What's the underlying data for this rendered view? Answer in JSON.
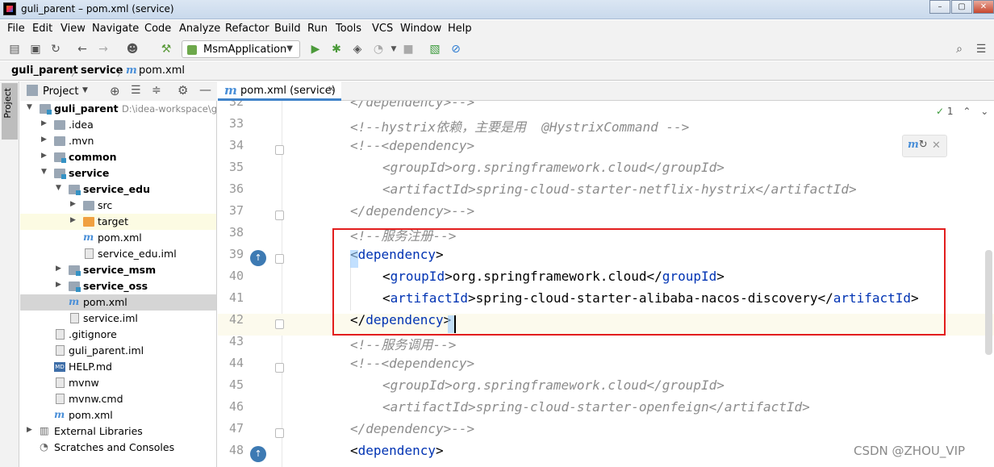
{
  "window": {
    "title": "guli_parent – pom.xml (service)"
  },
  "menu": [
    "File",
    "Edit",
    "View",
    "Navigate",
    "Code",
    "Analyze",
    "Refactor",
    "Build",
    "Run",
    "Tools",
    "VCS",
    "Window",
    "Help"
  ],
  "toolbar": {
    "run_config": "MsmApplication"
  },
  "breadcrumb": [
    "guli_parent",
    "service",
    "pom.xml"
  ],
  "project_panel": {
    "title": "Project"
  },
  "tree": [
    {
      "label": "guli_parent",
      "path": "D:\\idea-workspace\\gu",
      "bold": true
    },
    {
      "label": ".idea"
    },
    {
      "label": ".mvn"
    },
    {
      "label": "common",
      "bold": true
    },
    {
      "label": "service",
      "bold": true
    },
    {
      "label": "service_edu",
      "bold": true
    },
    {
      "label": "src"
    },
    {
      "label": "target"
    },
    {
      "label": "pom.xml"
    },
    {
      "label": "service_edu.iml"
    },
    {
      "label": "service_msm",
      "bold": true
    },
    {
      "label": "service_oss",
      "bold": true
    },
    {
      "label": "pom.xml"
    },
    {
      "label": "service.iml"
    },
    {
      "label": ".gitignore"
    },
    {
      "label": "guli_parent.iml"
    },
    {
      "label": "HELP.md"
    },
    {
      "label": "mvnw"
    },
    {
      "label": "mvnw.cmd"
    },
    {
      "label": "pom.xml"
    },
    {
      "label": "External Libraries"
    },
    {
      "label": "Scratches and Consoles"
    }
  ],
  "editor": {
    "tab": "pom.xml (service)",
    "inspection_count": "1",
    "lines": [
      {
        "n": "32",
        "indent": 0,
        "parts": [
          [
            "cmt",
            "</dependency>-->"
          ]
        ]
      },
      {
        "n": "33",
        "indent": 0,
        "parts": [
          [
            "cmt",
            "<!--hystrix依赖，主要是用  @HystrixCommand -->"
          ]
        ]
      },
      {
        "n": "34",
        "indent": 0,
        "parts": [
          [
            "cmt",
            "<!--<dependency>"
          ]
        ]
      },
      {
        "n": "35",
        "indent": 1,
        "parts": [
          [
            "cmt",
            "<groupId>org.springframework.cloud</groupId>"
          ]
        ]
      },
      {
        "n": "36",
        "indent": 1,
        "parts": [
          [
            "cmt",
            "<artifactId>spring-cloud-starter-netflix-hystrix</artifactId>"
          ]
        ]
      },
      {
        "n": "37",
        "indent": 0,
        "parts": [
          [
            "cmt",
            "</dependency>-->"
          ]
        ]
      },
      {
        "n": "38",
        "indent": 0,
        "parts": [
          [
            "cmt",
            "<!--服务注册-->"
          ]
        ]
      },
      {
        "n": "39",
        "indent": 0,
        "parts": [
          [
            "txt",
            "<"
          ],
          [
            "tagb",
            "dependency"
          ],
          [
            "txt",
            ">"
          ]
        ]
      },
      {
        "n": "40",
        "indent": 1,
        "parts": [
          [
            "txt",
            "<"
          ],
          [
            "tagb",
            "groupId"
          ],
          [
            "txt",
            ">org.springframework.cloud</"
          ],
          [
            "tagb",
            "groupId"
          ],
          [
            "txt",
            ">"
          ]
        ]
      },
      {
        "n": "41",
        "indent": 1,
        "parts": [
          [
            "txt",
            "<"
          ],
          [
            "tagb",
            "artifactId"
          ],
          [
            "txt",
            ">spring-cloud-starter-alibaba-nacos-discovery</"
          ],
          [
            "tagb",
            "artifactId"
          ],
          [
            "txt",
            ">"
          ]
        ]
      },
      {
        "n": "42",
        "indent": 0,
        "parts": [
          [
            "txt",
            "</"
          ],
          [
            "tagb",
            "dependency"
          ],
          [
            "txt",
            ">"
          ]
        ]
      },
      {
        "n": "43",
        "indent": 0,
        "parts": [
          [
            "cmt",
            "<!--服务调用-->"
          ]
        ]
      },
      {
        "n": "44",
        "indent": 0,
        "parts": [
          [
            "cmt",
            "<!--<dependency>"
          ]
        ]
      },
      {
        "n": "45",
        "indent": 1,
        "parts": [
          [
            "cmt",
            "<groupId>org.springframework.cloud</groupId>"
          ]
        ]
      },
      {
        "n": "46",
        "indent": 1,
        "parts": [
          [
            "cmt",
            "<artifactId>spring-cloud-starter-openfeign</artifactId>"
          ]
        ]
      },
      {
        "n": "47",
        "indent": 0,
        "parts": [
          [
            "cmt",
            "</dependency>-->"
          ]
        ]
      },
      {
        "n": "48",
        "indent": 0,
        "parts": [
          [
            "txt",
            "<"
          ],
          [
            "tagb",
            "dependency"
          ],
          [
            "txt",
            ">"
          ]
        ]
      }
    ]
  },
  "watermark": "CSDN @ZHOU_VIP"
}
